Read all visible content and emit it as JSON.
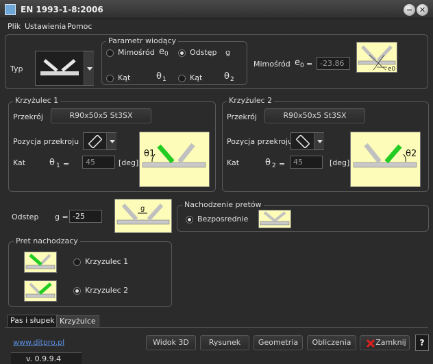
{
  "window": {
    "title": "EN 1993-1-8:2006",
    "minimize_glyph": "−",
    "close_glyph": "✕"
  },
  "menu": [
    "Plik",
    "Ustawienia",
    "Pomoc"
  ],
  "typ": {
    "label": "Typ"
  },
  "param": {
    "title": "Parametr wiodący",
    "options": [
      {
        "label": "Mimośród",
        "symbol": "e",
        "sub": "0",
        "selected": false
      },
      {
        "label": "Odstęp",
        "symbol": "g",
        "sub": "",
        "selected": true
      },
      {
        "label": "Kąt",
        "symbol": "θ",
        "sub": "1",
        "selected": false
      },
      {
        "label": "Kąt",
        "symbol": "θ",
        "sub": "2",
        "selected": false
      }
    ]
  },
  "mimosrod": {
    "label": "Mimośród",
    "symbol": "e",
    "sub": "0",
    "eq": "=",
    "value": "-23.86",
    "img_label": "e0"
  },
  "k1": {
    "title": "Krzyżulec 1",
    "przekroj_label": "Przekrój",
    "przekroj_value": "R90x50x5  St3SX",
    "pozycja_label": "Pozycja przekroju",
    "kat_label": "Kat",
    "theta": "θ",
    "theta_sub": "1",
    "eq": "=",
    "kat_value": "45",
    "unit": "[deg]",
    "img_label": "θ1"
  },
  "k2": {
    "title": "Krzyżulec 2",
    "przekroj_label": "Przekrój",
    "przekroj_value": "R90x50x5  St3SX",
    "pozycja_label": "Pozycja przekroju",
    "kat_label": "Kat",
    "theta": "θ",
    "theta_sub": "2",
    "eq": "=",
    "kat_value": "45",
    "unit": "[deg]",
    "img_label": "θ2"
  },
  "odstep": {
    "label": "Odstep",
    "g_label": "g =",
    "value": "-25",
    "img_label": "g"
  },
  "nachodzenie": {
    "title": "Nachodzenie pretów",
    "option": "Bezposrednie",
    "selected": true
  },
  "pret": {
    "title": "Pret nachodzacy",
    "options": [
      {
        "label": "Krzyzulec 1",
        "selected": false
      },
      {
        "label": "Krzyzulec 2",
        "selected": true
      }
    ]
  },
  "tabs": [
    "Pas i słupek",
    "Krzyżulce"
  ],
  "footer": {
    "link": "www.ditpro.pl",
    "version": "v. 0.9.9.4",
    "help": "?"
  },
  "buttons": {
    "widok": "Widok 3D",
    "rysunek": "Rysunek",
    "geometria": "Geometria",
    "obliczenia": "Obliczenia",
    "zamknij": "Zamknij"
  },
  "colors": {
    "accent_green": "#22cc22",
    "yellow_bg": "#fdfcb8",
    "link": "#5b8fe0"
  }
}
